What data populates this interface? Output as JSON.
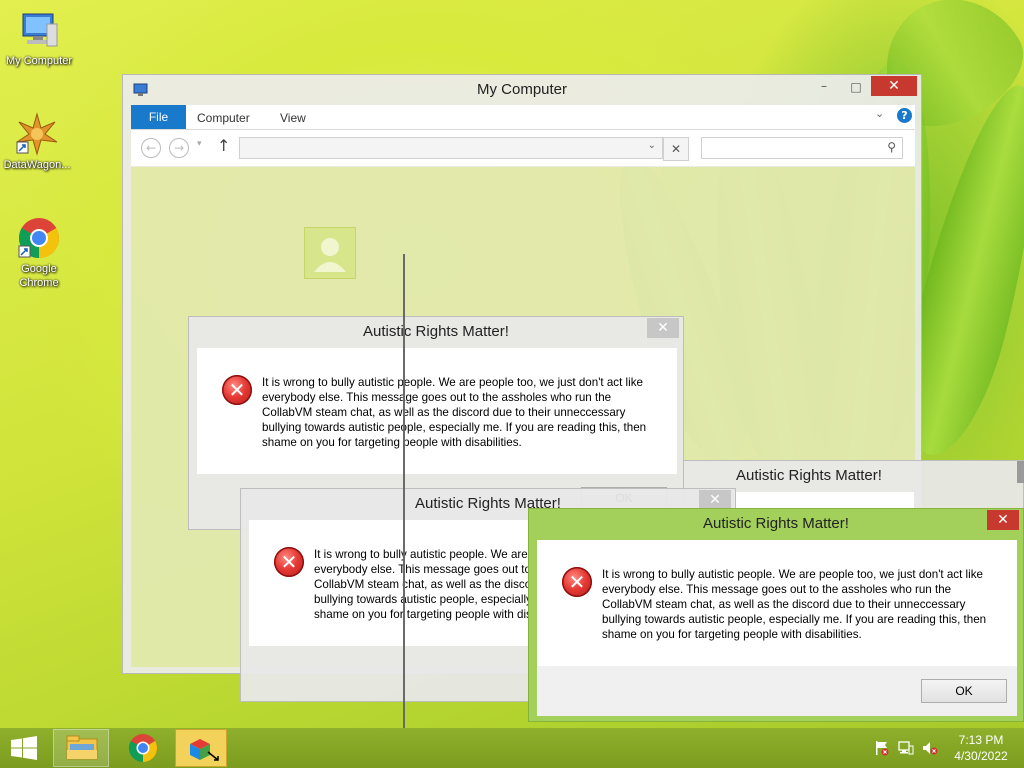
{
  "desktop": {
    "icons": [
      {
        "label": "My Computer"
      },
      {
        "label": "DataWagon..."
      },
      {
        "label_line1": "Google",
        "label_line2": "Chrome"
      }
    ]
  },
  "explorer": {
    "title": "My Computer",
    "ribbon_tabs": [
      "File",
      "Computer",
      "View"
    ],
    "address_value": "",
    "search_placeholder": ""
  },
  "dialogs": [
    {
      "title": "Autistic Rights Matter!",
      "message": "It is wrong to bully autistic people. We are people too, we just don't act like everybody else. This message goes out to the assholes who run the CollabVM steam chat, as well as the discord due to their unneccessary bullying towards autistic people, especially me. If you are reading this, then shame on you for targeting people with disabilities.",
      "ok_label": "OK"
    },
    {
      "title": "Autistic Rights Matter!",
      "message": "It is wrong to bully autistic people. We are people too, we just don't act like everybody else. This message goes out to the assholes who run the CollabVM steam chat, as well as the discord due to their unneccessary bullying towards autistic people, especially me. If you are reading this, then shame on you for targeting people with disabilities."
    },
    {
      "title": "Autistic Rights Matter!"
    },
    {
      "title": "Autistic Rights Matter!",
      "message": "It is wrong to bully autistic people. We are people too, we just don't act like everybody else. This message goes out to the assholes who run the CollabVM steam chat, as well as the discord due to their unneccessary bullying towards autistic people, especially me. If you are reading this, then shame on you for targeting people with disabilities.",
      "ok_label": "OK"
    }
  ],
  "taskbar": {
    "clock_time": "7:13 PM",
    "clock_date": "4/30/2022",
    "pinned": [
      "File Explorer",
      "Google Chrome",
      "Program"
    ]
  },
  "colors": {
    "ribbon_blue": "#1979ca",
    "close_red": "#c7392f",
    "taskbar_green": "#7f9f22",
    "active_frame": "#9ccc4a"
  }
}
